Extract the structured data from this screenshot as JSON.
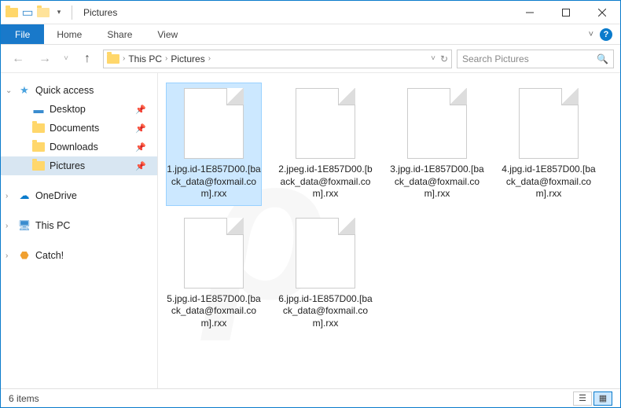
{
  "window": {
    "title": "Pictures"
  },
  "ribbon": {
    "file": "File",
    "tabs": [
      "Home",
      "Share",
      "View"
    ]
  },
  "breadcrumb": {
    "items": [
      "This PC",
      "Pictures"
    ]
  },
  "search": {
    "placeholder": "Search Pictures"
  },
  "sidebar": {
    "quick_access": {
      "label": "Quick access",
      "items": [
        {
          "label": "Desktop",
          "icon": "desktop",
          "pinned": true
        },
        {
          "label": "Documents",
          "icon": "documents",
          "pinned": true
        },
        {
          "label": "Downloads",
          "icon": "downloads",
          "pinned": true
        },
        {
          "label": "Pictures",
          "icon": "pictures",
          "pinned": true,
          "selected": true
        }
      ]
    },
    "onedrive": {
      "label": "OneDrive"
    },
    "this_pc": {
      "label": "This PC"
    },
    "catch": {
      "label": "Catch!"
    }
  },
  "files": [
    {
      "name": "1.jpg.id-1E857D00.[back_data@foxmail.com].rxx",
      "selected": true
    },
    {
      "name": "2.jpeg.id-1E857D00.[back_data@foxmail.com].rxx"
    },
    {
      "name": "3.jpg.id-1E857D00.[back_data@foxmail.com].rxx"
    },
    {
      "name": "4.jpg.id-1E857D00.[back_data@foxmail.com].rxx"
    },
    {
      "name": "5.jpg.id-1E857D00.[back_data@foxmail.com].rxx"
    },
    {
      "name": "6.jpg.id-1E857D00.[back_data@foxmail.com].rxx"
    }
  ],
  "status": {
    "count": "6 items"
  }
}
